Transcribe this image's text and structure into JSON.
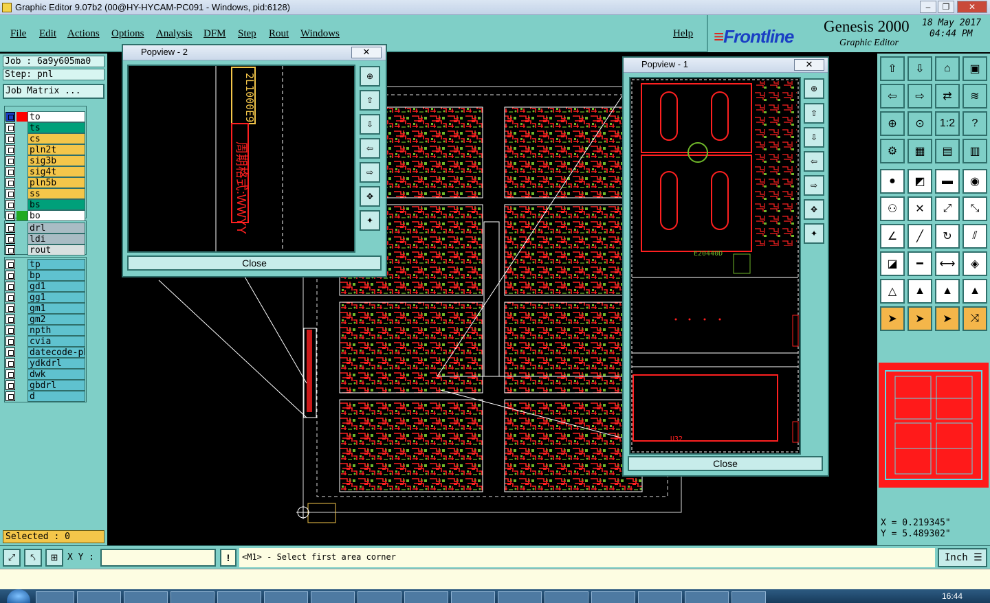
{
  "window": {
    "title": "Graphic Editor 9.07b2 (00@HY-HYCAM-PC091 - Windows, pid:6128)"
  },
  "menu": {
    "items": [
      "File",
      "Edit",
      "Actions",
      "Options",
      "Analysis",
      "DFM",
      "Step",
      "Rout",
      "Windows"
    ],
    "help": "Help"
  },
  "brand": {
    "logo": "Frontline",
    "product": "Genesis 2000",
    "subtitle": "Graphic Editor",
    "date": "18 May 2017",
    "time": "04:44 PM"
  },
  "job": {
    "job_label": "Job : 6a9y605ma0",
    "step_label": "Step: pnl",
    "matrix_button": "Job Matrix ..."
  },
  "layers": {
    "board": [
      {
        "name": "to",
        "color": "#ffffff",
        "mark": "#ff0000"
      },
      {
        "name": "ts",
        "color": "#00a07a",
        "mark": ""
      },
      {
        "name": "cs",
        "color": "#f4c64a",
        "mark": ""
      },
      {
        "name": "pln2t",
        "color": "#f4c64a",
        "mark": ""
      },
      {
        "name": "sig3b",
        "color": "#f4c64a",
        "mark": ""
      },
      {
        "name": "sig4t",
        "color": "#f4c64a",
        "mark": ""
      },
      {
        "name": "pln5b",
        "color": "#f4c64a",
        "mark": ""
      },
      {
        "name": "ss",
        "color": "#f4c64a",
        "mark": ""
      },
      {
        "name": "bs",
        "color": "#00a07a",
        "mark": ""
      },
      {
        "name": "bo",
        "color": "#ffffff",
        "mark": "#22aa22"
      }
    ],
    "drill": [
      {
        "name": "drl",
        "color": "#a9bcc4"
      },
      {
        "name": "ldi",
        "color": "#a9bcc4"
      },
      {
        "name": "rout",
        "color": "#d8e0e0"
      }
    ],
    "misc": [
      {
        "name": "tp",
        "color": "#5fc2cf"
      },
      {
        "name": "bp",
        "color": "#5fc2cf"
      },
      {
        "name": "gd1",
        "color": "#5fc2cf"
      },
      {
        "name": "gg1",
        "color": "#5fc2cf"
      },
      {
        "name": "gm1",
        "color": "#5fc2cf"
      },
      {
        "name": "gm2",
        "color": "#5fc2cf"
      },
      {
        "name": "npth",
        "color": "#5fc2cf"
      },
      {
        "name": "cvia",
        "color": "#5fc2cf"
      },
      {
        "name": "datecode-pbo",
        "color": "#5fc2cf"
      },
      {
        "name": "ydkdrl",
        "color": "#5fc2cf"
      },
      {
        "name": "dwk",
        "color": "#5fc2cf"
      },
      {
        "name": "gbdrl",
        "color": "#5fc2cf"
      },
      {
        "name": "d",
        "color": "#5fc2cf"
      }
    ]
  },
  "selected": "Selected : 0",
  "popview2": {
    "title": "Popview - 2",
    "close": "Close",
    "vertical_text": "周期格式:WWYY",
    "code_text": "2L1000E9"
  },
  "popview1": {
    "title": "Popview - 1",
    "close": "Close",
    "label_a": "E20440D",
    "label_b": "U32"
  },
  "coords": {
    "x": "X = 0.219345\"",
    "y": "Y = 5.489302\""
  },
  "status": {
    "xy_label": "X Y :",
    "xy_value": "",
    "message": "<M1> - Select first area corner",
    "units": "Inch"
  },
  "taskbar": {
    "clock": "16:44"
  },
  "colors": {
    "panel": "#7fcfc7",
    "copper_red": "#ff1a1a",
    "copper_green": "#6fb82a"
  }
}
